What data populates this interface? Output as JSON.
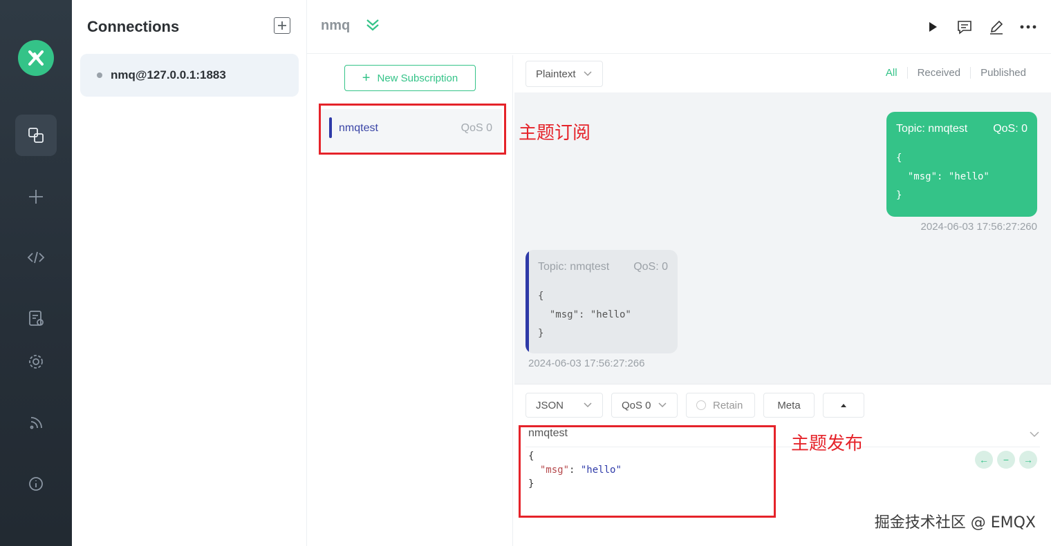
{
  "sidebar": {
    "icons": [
      "emqx-logo-icon",
      "connections-icon",
      "plus-icon",
      "script-icon",
      "log-icon",
      "settings-icon",
      "feed-icon",
      "info-icon"
    ]
  },
  "connections": {
    "title": "Connections",
    "items": [
      {
        "label": "nmq@127.0.0.1:1883"
      }
    ]
  },
  "header": {
    "connection_name": "nmq"
  },
  "subscriptions": {
    "new_button": "New Subscription",
    "items": [
      {
        "topic": "nmqtest",
        "qos": "QoS 0"
      }
    ]
  },
  "messages": {
    "format": "Plaintext",
    "filters": [
      "All",
      "Received",
      "Published"
    ],
    "published": {
      "topic_label": "Topic: nmqtest",
      "qos_label": "QoS: 0",
      "payload": "{\n  \"msg\": \"hello\"\n}",
      "time": "2024-06-03 17:56:27:260"
    },
    "received": {
      "topic_label": "Topic: nmqtest",
      "qos_label": "QoS: 0",
      "payload": "{\n  \"msg\": \"hello\"\n}",
      "time": "2024-06-03 17:56:27:266"
    }
  },
  "publish": {
    "format": "JSON",
    "qos": "QoS 0",
    "retain_label": "Retain",
    "meta_label": "Meta",
    "topic": "nmqtest",
    "payload_open": "{",
    "payload_key": "\"msg\"",
    "payload_sep": ": ",
    "payload_value": "\"hello\"",
    "payload_close": "}"
  },
  "annotations": {
    "subscribe_label": "主题订阅",
    "publish_label": "主题发布",
    "color": "#e5232a"
  },
  "watermark": "掘金技术社区 @ EMQX",
  "colors": {
    "accent": "#34c388",
    "topic_bar": "#2e3aa8",
    "rail": "#2b353f"
  }
}
